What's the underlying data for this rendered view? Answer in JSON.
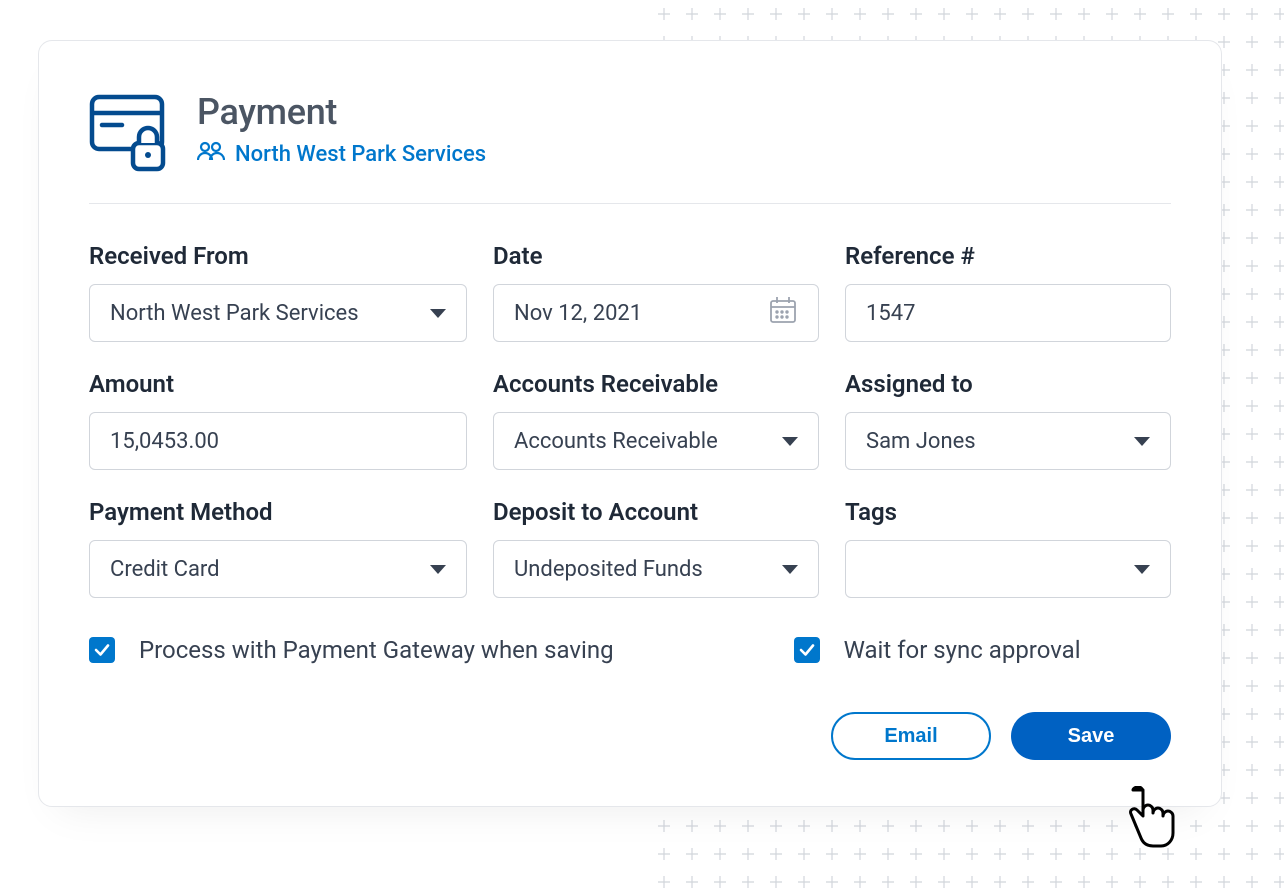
{
  "header": {
    "title": "Payment",
    "customer_name": "North West Park Services"
  },
  "fields": {
    "received_from": {
      "label": "Received From",
      "value": "North West Park Services"
    },
    "date": {
      "label": "Date",
      "value": "Nov 12, 2021"
    },
    "reference": {
      "label": "Reference #",
      "value": "1547"
    },
    "amount": {
      "label": "Amount",
      "value": "15,0453.00"
    },
    "accounts_receivable": {
      "label": "Accounts Receivable",
      "value": "Accounts Receivable"
    },
    "assigned_to": {
      "label": "Assigned to",
      "value": "Sam Jones"
    },
    "payment_method": {
      "label": "Payment Method",
      "value": "Credit Card"
    },
    "deposit_to": {
      "label": "Deposit to Account",
      "value": "Undeposited Funds"
    },
    "tags": {
      "label": "Tags",
      "value": ""
    }
  },
  "checkboxes": {
    "process_gateway": {
      "label": "Process with Payment Gateway when saving",
      "checked": true
    },
    "wait_sync": {
      "label": "Wait for sync approval",
      "checked": true
    }
  },
  "actions": {
    "email": "Email",
    "save": "Save"
  },
  "colors": {
    "accent": "#0077cc",
    "primary_button": "#0061c2"
  }
}
